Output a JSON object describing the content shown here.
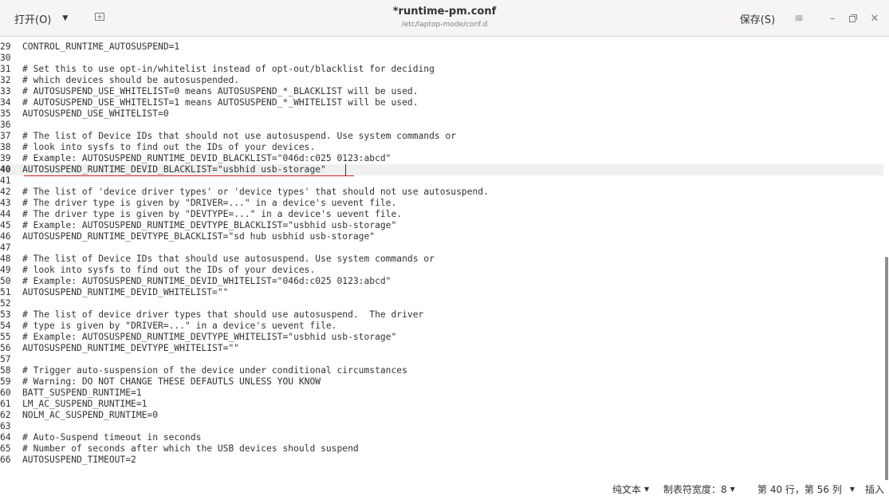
{
  "header": {
    "open_label": "打开(O)",
    "open_caret": "▼",
    "new_tab_icon": "new-tab-icon",
    "title": "*runtime-pm.conf",
    "subtitle": "/etc/laptop-mode/conf.d",
    "save_label": "保存(S)",
    "menu_icon": "≡",
    "minimize": "–",
    "maximize": "ō",
    "close": "✕"
  },
  "editor": {
    "current_line": "40",
    "lines": [
      {
        "n": "29",
        "text": "CONTROL_RUNTIME_AUTOSUSPEND=1"
      },
      {
        "n": "30",
        "text": ""
      },
      {
        "n": "31",
        "text": "# Set this to use opt-in/whitelist instead of opt-out/blacklist for deciding"
      },
      {
        "n": "32",
        "text": "# which devices should be autosuspended."
      },
      {
        "n": "33",
        "text": "# AUTOSUSPEND_USE_WHITELIST=0 means AUTOSUSPEND_*_BLACKLIST will be used."
      },
      {
        "n": "34",
        "text": "# AUTOSUSPEND_USE_WHITELIST=1 means AUTOSUSPEND_*_WHITELIST will be used."
      },
      {
        "n": "35",
        "text": "AUTOSUSPEND_USE_WHITELIST=0"
      },
      {
        "n": "36",
        "text": ""
      },
      {
        "n": "37",
        "text": "# The list of Device IDs that should not use autosuspend. Use system commands or"
      },
      {
        "n": "38",
        "text": "# look into sysfs to find out the IDs of your devices."
      },
      {
        "n": "39",
        "text": "# Example: AUTOSUSPEND_RUNTIME_DEVID_BLACKLIST=\"046d:c025 0123:abcd\""
      },
      {
        "n": "40",
        "text": "AUTOSUSPEND_RUNTIME_DEVID_BLACKLIST=\"usbhid usb-storage\""
      },
      {
        "n": "41",
        "text": ""
      },
      {
        "n": "42",
        "text": "# The list of 'device driver types' or 'device types' that should not use autosuspend."
      },
      {
        "n": "43",
        "text": "# The driver type is given by \"DRIVER=...\" in a device's uevent file."
      },
      {
        "n": "44",
        "text": "# The driver type is given by \"DEVTYPE=...\" in a device's uevent file."
      },
      {
        "n": "45",
        "text": "# Example: AUTOSUSPEND_RUNTIME_DEVTYPE_BLACKLIST=\"usbhid usb-storage\""
      },
      {
        "n": "46",
        "text": "AUTOSUSPEND_RUNTIME_DEVTYPE_BLACKLIST=\"sd hub usbhid usb-storage\""
      },
      {
        "n": "47",
        "text": ""
      },
      {
        "n": "48",
        "text": "# The list of Device IDs that should use autosuspend. Use system commands or"
      },
      {
        "n": "49",
        "text": "# look into sysfs to find out the IDs of your devices."
      },
      {
        "n": "50",
        "text": "# Example: AUTOSUSPEND_RUNTIME_DEVID_WHITELIST=\"046d:c025 0123:abcd\""
      },
      {
        "n": "51",
        "text": "AUTOSUSPEND_RUNTIME_DEVID_WHITELIST=\"\""
      },
      {
        "n": "52",
        "text": ""
      },
      {
        "n": "53",
        "text": "# The list of device driver types that should use autosuspend.  The driver"
      },
      {
        "n": "54",
        "text": "# type is given by \"DRIVER=...\" in a device's uevent file."
      },
      {
        "n": "55",
        "text": "# Example: AUTOSUSPEND_RUNTIME_DEVTYPE_WHITELIST=\"usbhid usb-storage\""
      },
      {
        "n": "56",
        "text": "AUTOSUSPEND_RUNTIME_DEVTYPE_WHITELIST=\"\""
      },
      {
        "n": "57",
        "text": ""
      },
      {
        "n": "58",
        "text": "# Trigger auto-suspension of the device under conditional circumstances"
      },
      {
        "n": "59",
        "text": "# Warning: DO NOT CHANGE THESE DEFAUTLS UNLESS YOU KNOW"
      },
      {
        "n": "60",
        "text": "BATT_SUSPEND_RUNTIME=1"
      },
      {
        "n": "61",
        "text": "LM_AC_SUSPEND_RUNTIME=1"
      },
      {
        "n": "62",
        "text": "NOLM_AC_SUSPEND_RUNTIME=0"
      },
      {
        "n": "63",
        "text": ""
      },
      {
        "n": "64",
        "text": "# Auto-Suspend timeout in seconds"
      },
      {
        "n": "65",
        "text": "# Number of seconds after which the USB devices should suspend"
      },
      {
        "n": "66",
        "text": "AUTOSUSPEND_TIMEOUT=2"
      }
    ]
  },
  "statusbar": {
    "syntax": "纯文本",
    "tab_width": "制表符宽度：8",
    "position": "第 40 行，第 56 列",
    "mode": "插入",
    "caret": "▼"
  }
}
